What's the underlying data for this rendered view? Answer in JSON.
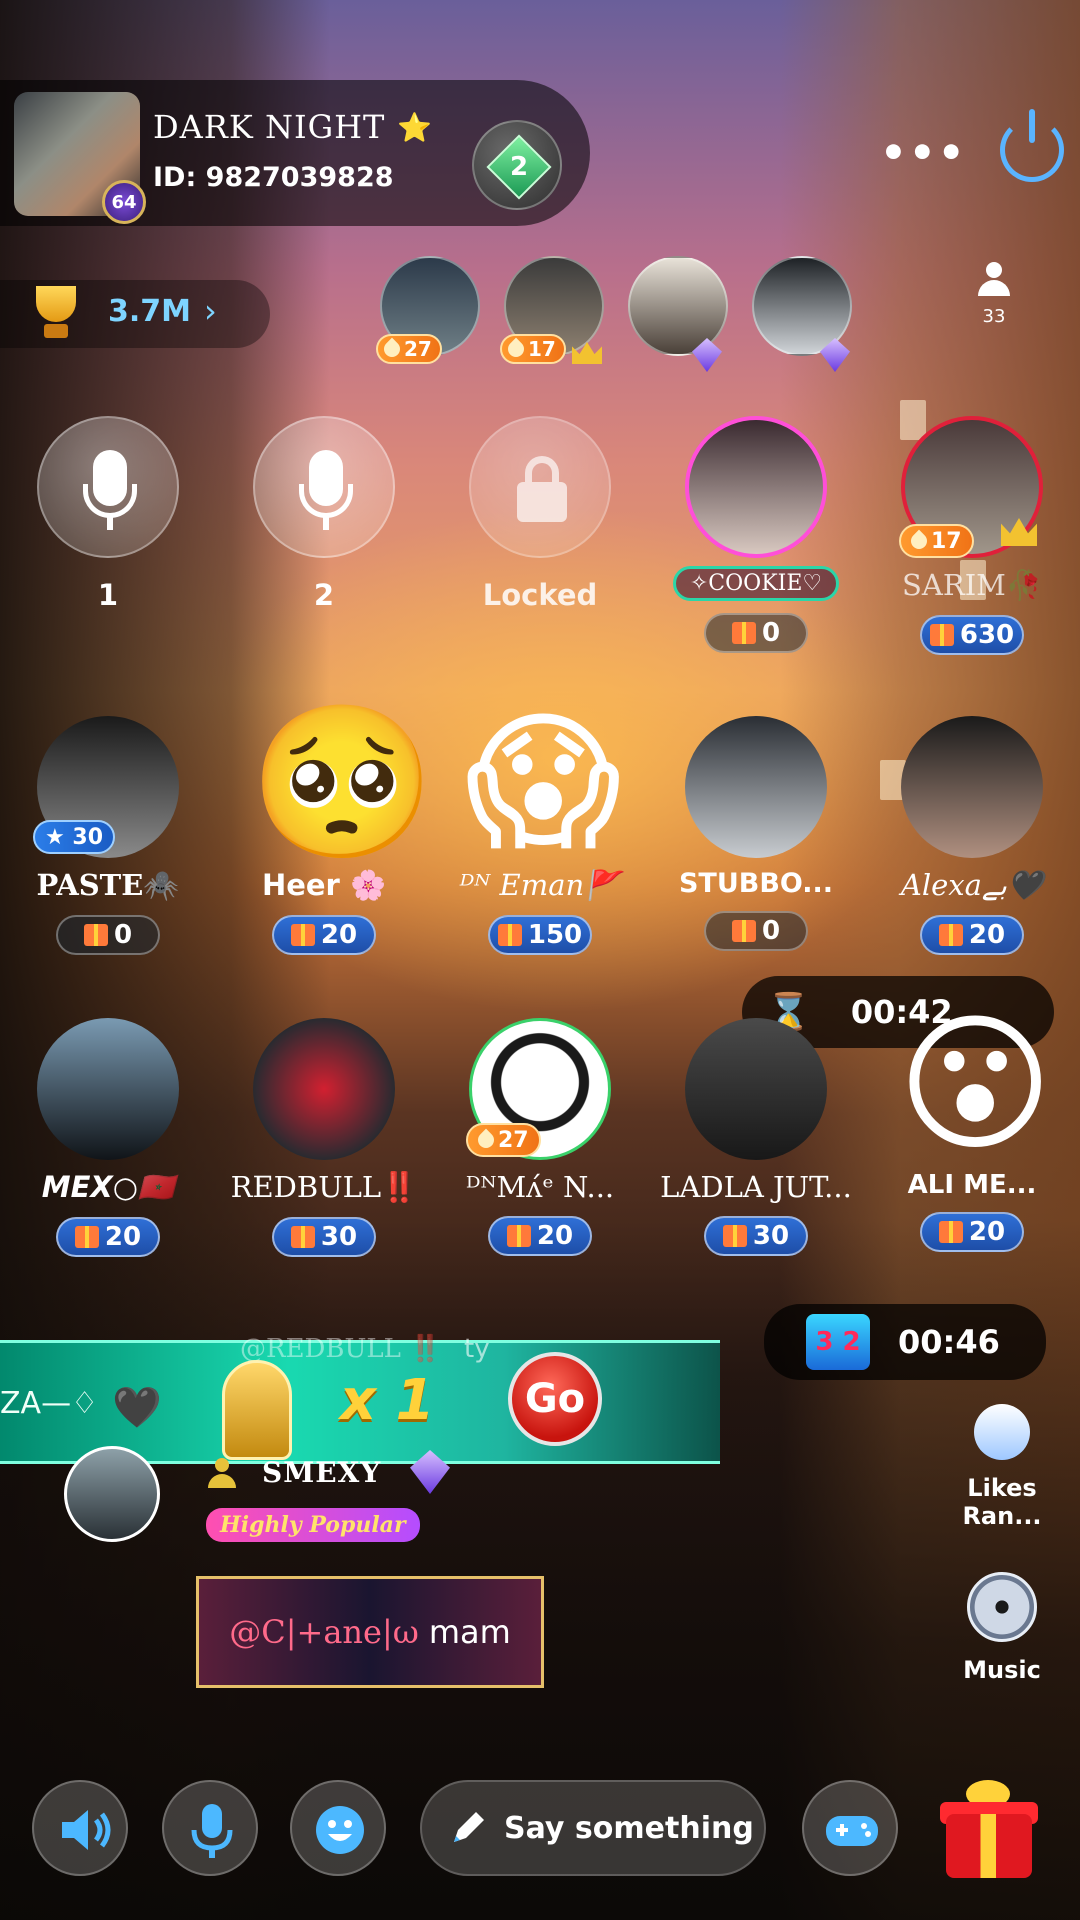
{
  "room": {
    "title": "DARK NIGHT",
    "title_star": "⭐",
    "id_label": "ID: 9827039828",
    "cover_badge": "64",
    "gem_level": "2",
    "more_label": "•••"
  },
  "trophy": {
    "value": "3.7M",
    "chevron": "›"
  },
  "viewers": [
    {
      "level": "27",
      "colors": [
        "#2c3a4a",
        "#6f7f86"
      ]
    },
    {
      "level": "17",
      "colors": [
        "#3b3b3b",
        "#8d8070"
      ]
    },
    {
      "level": "",
      "colors": [
        "#e8e2d8",
        "#4a4038"
      ]
    },
    {
      "level": "",
      "colors": [
        "#1e2226",
        "#d0d4d8"
      ]
    }
  ],
  "online_count": "33",
  "seats_row1": [
    {
      "label": "1",
      "kind": "mic"
    },
    {
      "label": "2",
      "kind": "mic"
    },
    {
      "label": "Locked",
      "kind": "lock"
    },
    {
      "tag": "✧COOKIE♡",
      "gifts": "0",
      "kind": "user"
    },
    {
      "label": "SARIM🥀",
      "level": "17",
      "gifts": "630",
      "kind": "user"
    }
  ],
  "seats_row2": [
    {
      "name": "PASTE🕷️",
      "badge": "30",
      "gifts": "0"
    },
    {
      "name": "Heer 🌸",
      "emoji": "🥺",
      "gifts": "20"
    },
    {
      "name": "ᴰᴺ Eman🚩",
      "emoji": "😱",
      "gifts": "150"
    },
    {
      "name": "STUBBO...",
      "gifts": "0"
    },
    {
      "name": "Alexaبے🖤",
      "gifts": "20"
    }
  ],
  "seats_row3": [
    {
      "name": "MEX○🇲🇦",
      "gifts": "20"
    },
    {
      "name": "REDBULL‼️",
      "gifts": "30"
    },
    {
      "name": "ᴰᴺMʌ́ᵉ N...",
      "level": "27",
      "gifts": "20"
    },
    {
      "name": "LADLA JUT...",
      "gifts": "30"
    },
    {
      "name": "ALI ME...",
      "emoji": "😮",
      "gifts": "20"
    }
  ],
  "timers": {
    "hourglass": "00:42",
    "dice": "00:46",
    "dice_face": "3 2"
  },
  "banner": {
    "ghost_name": "@REDBULL ‼️",
    "ghost_suffix": "ty",
    "left_text": "ZA—♢",
    "heart": "🖤",
    "multiplier": "x 1",
    "go_label": "Go"
  },
  "sender": {
    "name": "SMEXY",
    "badge": "Highly Popular"
  },
  "message": {
    "mention": "@C|+ane|ω",
    "text": "mam"
  },
  "side_buttons": {
    "likes": "Likes Ran...",
    "music": "Music"
  },
  "bottom_bar": {
    "input_placeholder": "Say something"
  },
  "colors": {
    "accent": "#1fb5a0",
    "gift_pill": "#2f6fd6",
    "level": "#f07316"
  }
}
